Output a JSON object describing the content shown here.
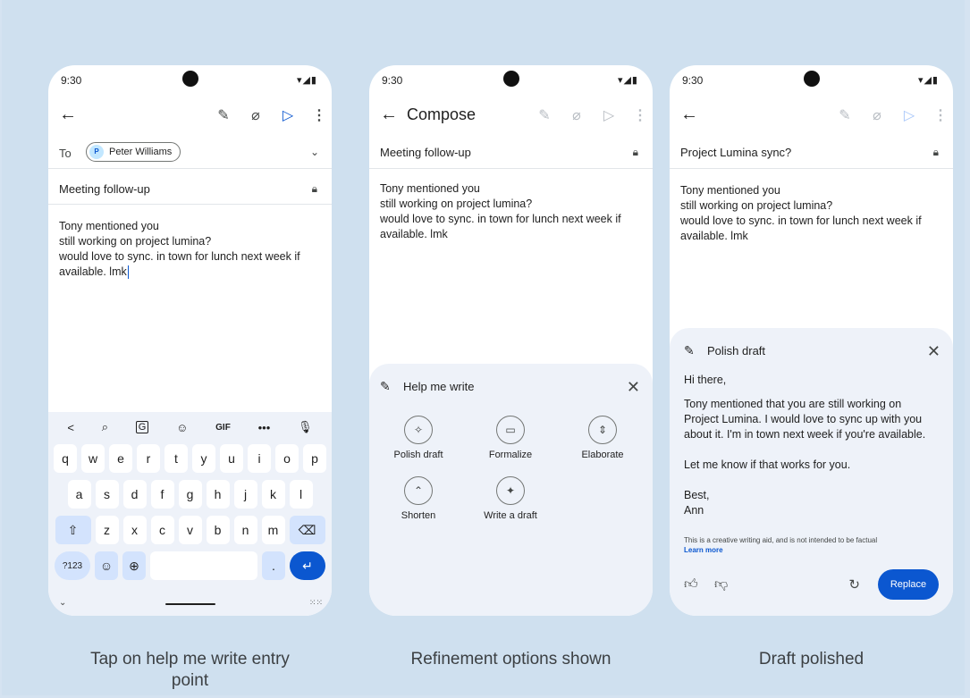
{
  "status": {
    "time": "9:30",
    "system_icons": "▾◢▮"
  },
  "phone1": {
    "to_label": "To",
    "recipient_initial": "P",
    "recipient_name": "Peter Williams",
    "subject": "Meeting follow-up",
    "body": [
      "Tony mentioned you",
      "still working on project lumina?",
      "would love to sync. in town for lunch next week if",
      "available. lmk"
    ],
    "keyboard": {
      "toolbar": [
        "<",
        "🔍",
        "🈳",
        "☺",
        "GIF",
        "•••",
        "🎤"
      ],
      "row1": [
        "q",
        "w",
        "e",
        "r",
        "t",
        "y",
        "u",
        "i",
        "o",
        "p"
      ],
      "row2": [
        "a",
        "s",
        "d",
        "f",
        "g",
        "h",
        "j",
        "k",
        "l"
      ],
      "row3": [
        "z",
        "x",
        "c",
        "v",
        "b",
        "n",
        "m"
      ],
      "symbols_key": "?123",
      "period_key": "."
    }
  },
  "phone2": {
    "title": "Compose",
    "subject": "Meeting follow-up",
    "body": [
      "Tony mentioned you",
      "still working on project lumina?",
      "would love to sync. in town for lunch next week if",
      "available. lmk"
    ],
    "sheet_title": "Help me write",
    "options": [
      {
        "label": "Polish draft",
        "icon": "wand-icon"
      },
      {
        "label": "Formalize",
        "icon": "briefcase-icon"
      },
      {
        "label": "Elaborate",
        "icon": "expand-text-icon"
      },
      {
        "label": "Shorten",
        "icon": "shorten-icon"
      },
      {
        "label": "Write a draft",
        "icon": "sparkle-icon"
      }
    ]
  },
  "phone3": {
    "subject": "Project Lumina sync?",
    "body": [
      "Tony mentioned you",
      "still working on project lumina?",
      "would love to sync. in town for lunch next week if",
      "available. lmk"
    ],
    "sheet_title": "Polish draft",
    "greeting": "Hi there,",
    "para1": [
      "Tony mentioned that you are still working on",
      "Project Lumina. I would love to sync up with you",
      "about it. I'm in town next week if you're available."
    ],
    "para2": "Let me know if that works for you.",
    "signoff": "Best,",
    "signature": "Ann",
    "disclaimer": "This is a creative writing aid, and is not intended to be factual",
    "learn_more": "Learn more",
    "replace_label": "Replace"
  },
  "captions": {
    "c1_line1": "Tap on help me write entry",
    "c1_line2": "point",
    "c2": "Refinement options shown",
    "c3": "Draft polished"
  },
  "colors": {
    "accent": "#0b57d0",
    "background": "#cfe0ef",
    "sheet": "#eef2f9"
  }
}
